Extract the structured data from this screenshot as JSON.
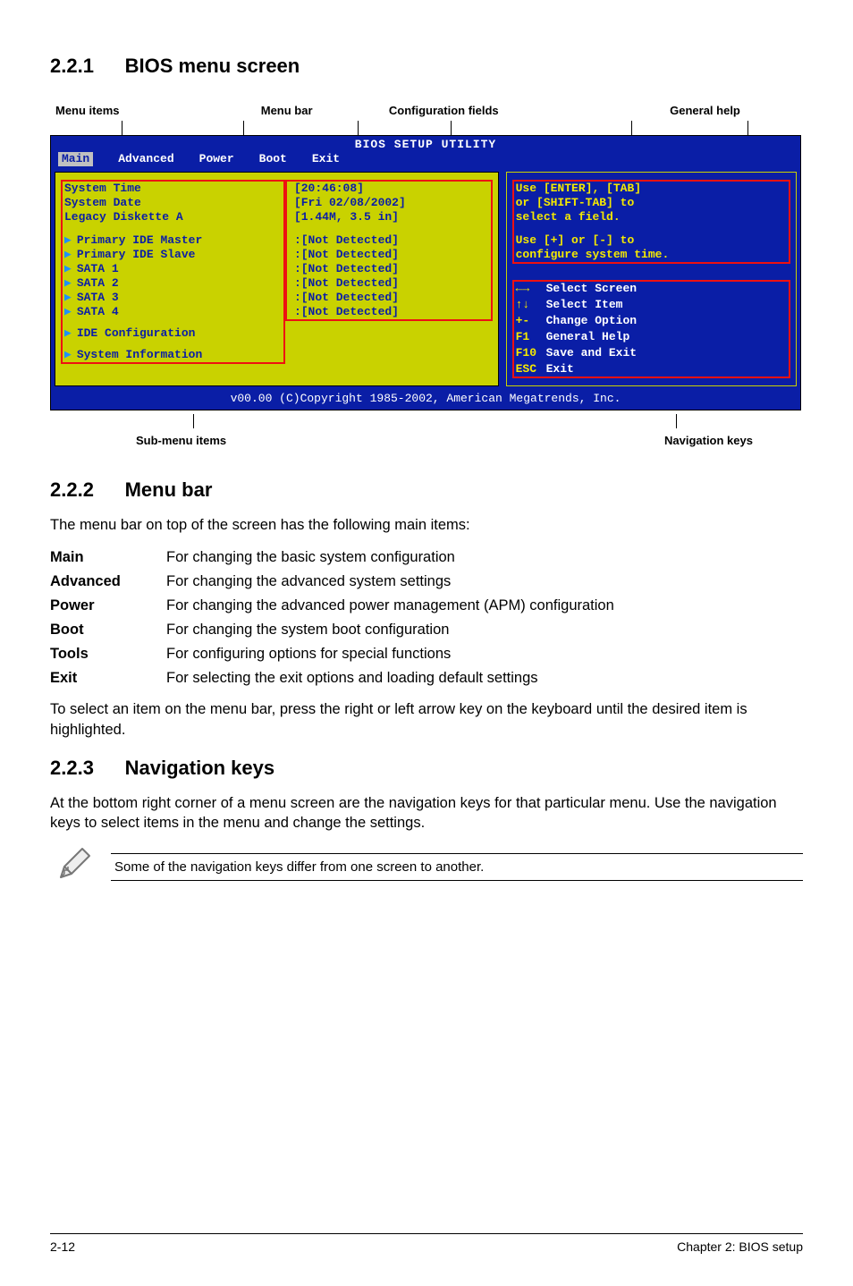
{
  "sections": {
    "s1_num": "2.2.1",
    "s1_title": "BIOS menu screen",
    "s2_num": "2.2.2",
    "s2_title": "Menu bar",
    "s3_num": "2.2.3",
    "s3_title": "Navigation keys"
  },
  "labels": {
    "menu_items": "Menu items",
    "menu_bar": "Menu bar",
    "config_fields": "Configuration fields",
    "general_help": "General help",
    "sub_menu": "Sub-menu items",
    "nav_keys": "Navigation keys"
  },
  "bios": {
    "title": "BIOS SETUP UTILITY",
    "tabs": {
      "main": "Main",
      "advanced": "Advanced",
      "power": "Power",
      "boot": "Boot",
      "exit": "Exit"
    },
    "left_items": {
      "system_time": "System Time",
      "system_date": "System Date",
      "legacy": "Legacy Diskette A",
      "p_ide_master": "Primary IDE Master",
      "p_ide_slave": "Primary IDE Slave",
      "sata1": "SATA 1",
      "sata2": "SATA 2",
      "sata3": "SATA 3",
      "sata4": "SATA 4",
      "ide_conf": "IDE Configuration",
      "sys_info": "System Information"
    },
    "values": {
      "time": "[20:46:08]",
      "date": "[Fri 02/08/2002]",
      "disk": "[1.44M, 3.5 in]",
      "nd": ":[Not Detected]"
    },
    "help": {
      "line1": "Use [ENTER], [TAB]",
      "line2": "or [SHIFT-TAB] to",
      "line3": "select a field.",
      "line4": "Use [+] or [-] to",
      "line5": "configure system time."
    },
    "keys": {
      "lr": "←→",
      "lr_t": "Select Screen",
      "ud": "↑↓",
      "ud_t": "Select Item",
      "pm": "+-",
      "pm_t": "Change Option",
      "f1": "F1",
      "f1_t": "General Help",
      "f10": "F10",
      "f10_t": "Save and Exit",
      "esc": "ESC",
      "esc_t": "Exit"
    },
    "copyright": "v00.00 (C)Copyright 1985-2002, American Megatrends, Inc."
  },
  "menu_bar_intro": "The menu bar on top of the screen has the following main items:",
  "menu_desc": {
    "main_t": "Main",
    "main_d": "For changing the basic system configuration",
    "adv_t": "Advanced",
    "adv_d": "For changing the advanced system settings",
    "pow_t": "Power",
    "pow_d": "For changing the advanced power management (APM) configuration",
    "boot_t": "Boot",
    "boot_d": "For changing the system boot configuration",
    "tools_t": "Tools",
    "tools_d": "For configuring options for special functions",
    "exit_t": "Exit",
    "exit_d": "For selecting the exit options and loading default settings"
  },
  "menu_bar_outro": "To select an item on the menu bar, press the right or left arrow key on the keyboard until the desired item is highlighted.",
  "nav_desc": "At the bottom right corner of a menu screen are the navigation keys for that particular menu. Use the navigation keys to select items in the menu and change the settings.",
  "note": "Some of the navigation keys differ from one screen to another.",
  "footer": {
    "left": "2-12",
    "right": "Chapter 2: BIOS setup"
  }
}
